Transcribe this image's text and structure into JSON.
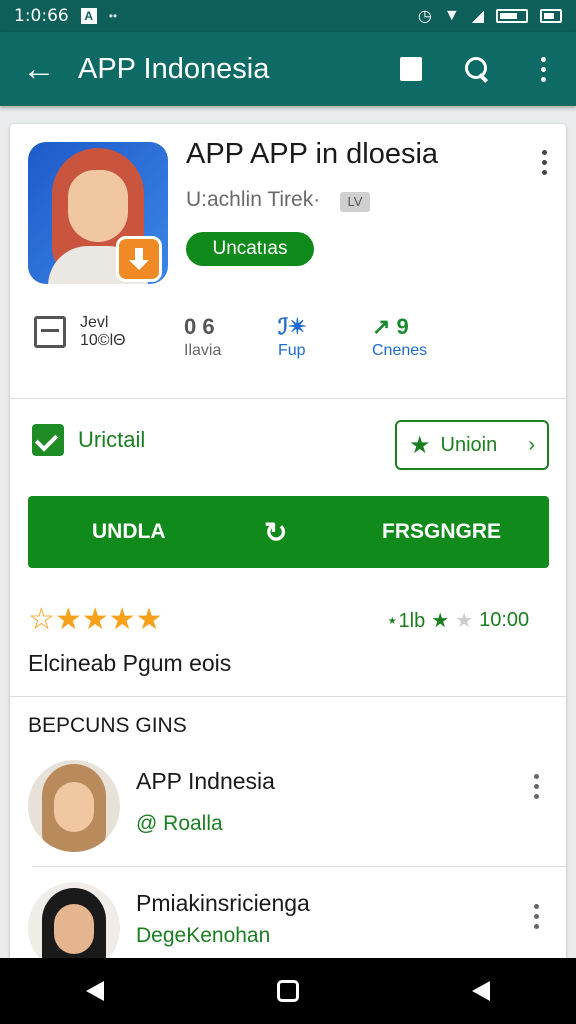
{
  "status_bar": {
    "time": "1:0:66",
    "badge": "A",
    "dots": "••"
  },
  "toolbar": {
    "title": "APP Indonesia"
  },
  "app": {
    "title": "APP APP in dloesia",
    "developer": "U:achlin Tirek·",
    "developer_badge": "LV",
    "tag": "Uncatıas"
  },
  "stats": [
    {
      "top": "Jevl",
      "bottom": "10©lΘ"
    },
    {
      "top": "0 6",
      "bottom": "Ilavia"
    },
    {
      "top": "ℐ✴",
      "bottom": "Fup"
    },
    {
      "top": "↗ 9",
      "bottom": "Cnenes"
    }
  ],
  "install": {
    "label": "Urictail",
    "wishlist_label": "Unioin"
  },
  "main_button": {
    "left": "UNDLA",
    "center": "↻",
    "right": "FRSGNGRE"
  },
  "rating": {
    "stars": "☆★★★★",
    "right_text": "⋆1lb",
    "right_num": "10:00"
  },
  "review_text": "Elcineab Pgum eois",
  "section": {
    "heading": "BEPCUNS GINS"
  },
  "list_items": [
    {
      "name": "APP Indnesia",
      "sub": "@ Roalla"
    },
    {
      "name": "Pmiakinsricienga",
      "sub": "DegeKenohan"
    }
  ],
  "colors": {
    "primary": "#0e6a64",
    "accent_green": "#118a1c",
    "star": "#f5a21a"
  }
}
